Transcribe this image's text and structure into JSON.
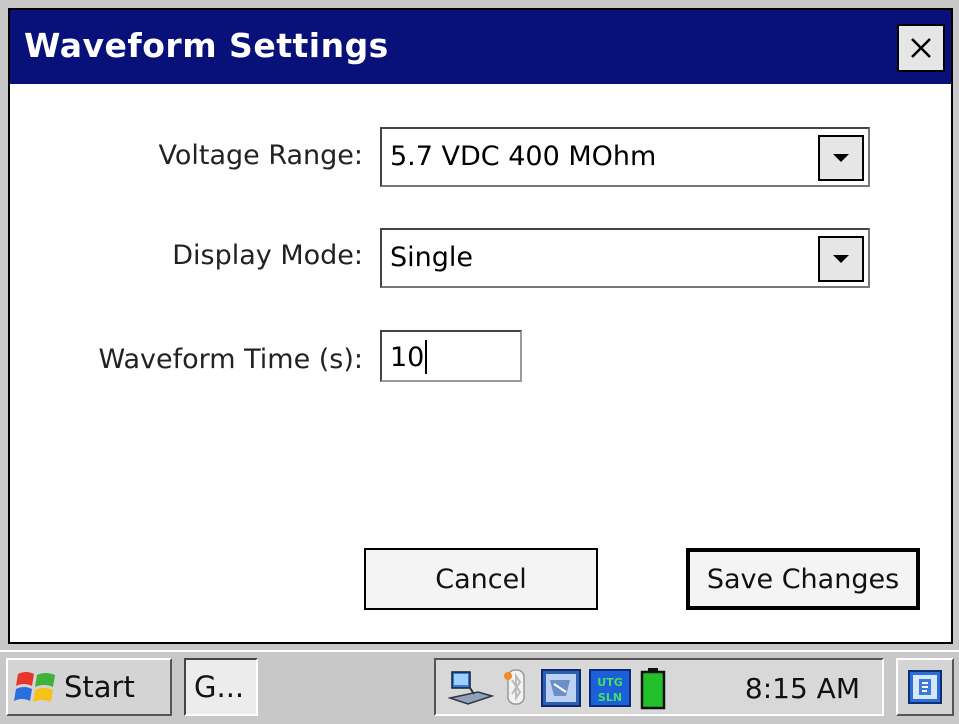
{
  "window": {
    "title": "Waveform Settings",
    "title_bar_color": "#08107a",
    "close_icon": "close-icon"
  },
  "form": {
    "voltage_range": {
      "label": "Voltage Range:",
      "value": "5.7 VDC 400 MOhm"
    },
    "display_mode": {
      "label": "Display Mode:",
      "value": "Single"
    },
    "waveform_time": {
      "label": "Waveform Time (s):",
      "value": "10"
    }
  },
  "buttons": {
    "cancel": "Cancel",
    "save": "Save Changes"
  },
  "taskbar": {
    "start_label": "Start",
    "task_label": "G...",
    "clock": "8:15 AM",
    "tray_icons": [
      "network-icon",
      "bluetooth-icon",
      "sync-icon",
      "utg-sln-icon",
      "battery-icon"
    ],
    "desktop_icon": "desktop-icon"
  }
}
